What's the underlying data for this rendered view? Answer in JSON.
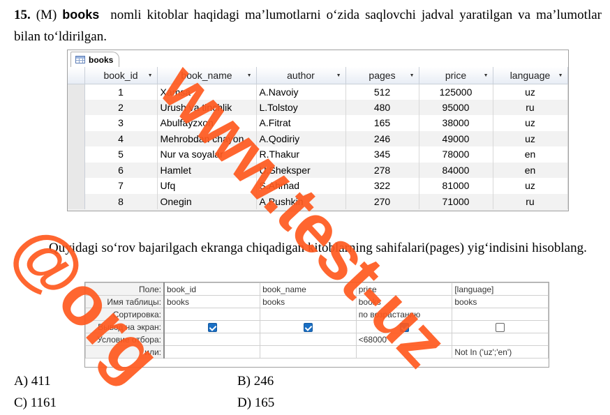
{
  "question": {
    "number": "15.",
    "prefix": "(M)",
    "keyword": "books",
    "text_line1_rest": "nomli kitoblar haqidagi ma’lumotlarni o‘zida saqlovchi jadval yaratilgan",
    "text_line2": "va ma’lumotlar bilan to‘ldirilgan."
  },
  "datasheet": {
    "tab_label": "books",
    "columns": [
      "book_id",
      "book_name",
      "author",
      "pages",
      "price",
      "language"
    ],
    "rows": [
      [
        "1",
        "Xamsa",
        "A.Navoiy",
        "512",
        "125000",
        "uz"
      ],
      [
        "2",
        "Urush va tinchlik",
        "L.Tolstoy",
        "480",
        "95000",
        "ru"
      ],
      [
        "3",
        "Abulfayzxon",
        "A.Fitrat",
        "165",
        "38000",
        "uz"
      ],
      [
        "4",
        "Mehrobdan chayon",
        "A.Qodiriy",
        "246",
        "49000",
        "uz"
      ],
      [
        "5",
        "Nur va soyalar",
        "R.Thakur",
        "345",
        "78000",
        "en"
      ],
      [
        "6",
        "Hamlet",
        "U.Sheksper",
        "278",
        "84000",
        "en"
      ],
      [
        "7",
        "Ufq",
        "S.Ahmad",
        "322",
        "81000",
        "uz"
      ],
      [
        "8",
        "Onegin",
        "A.Pushkin",
        "270",
        "71000",
        "ru"
      ]
    ]
  },
  "question2": {
    "text": "Quyidagi so‘rov bajarilgach ekranga chiqadigan kitoblarning sahifalari(pages) yig‘indisini hisoblang."
  },
  "query_grid": {
    "row_labels": [
      "Поле:",
      "Имя таблицы:",
      "Сортировка:",
      "Вывод на экран:",
      "Условие отбора:",
      "или:"
    ],
    "field": [
      "book_id",
      "book_name",
      "price",
      "[language]"
    ],
    "table": [
      "books",
      "books",
      "books",
      "books"
    ],
    "sort": [
      "",
      "",
      "по возрастанию",
      ""
    ],
    "show": [
      true,
      true,
      true,
      false
    ],
    "criteria": [
      "",
      "",
      "<68000",
      ""
    ],
    "or": [
      "",
      "",
      "",
      "Not In ('uz';'en')"
    ]
  },
  "answers": {
    "a": "A) 411",
    "b": "B) 246",
    "c": "C) 1161",
    "d": "D) 165"
  },
  "watermark": {
    "site": "www.test-uz",
    "handle": "@org"
  },
  "colors": {
    "watermark": "#ff5a1f",
    "checkbox_on": "#1a6fc4"
  }
}
